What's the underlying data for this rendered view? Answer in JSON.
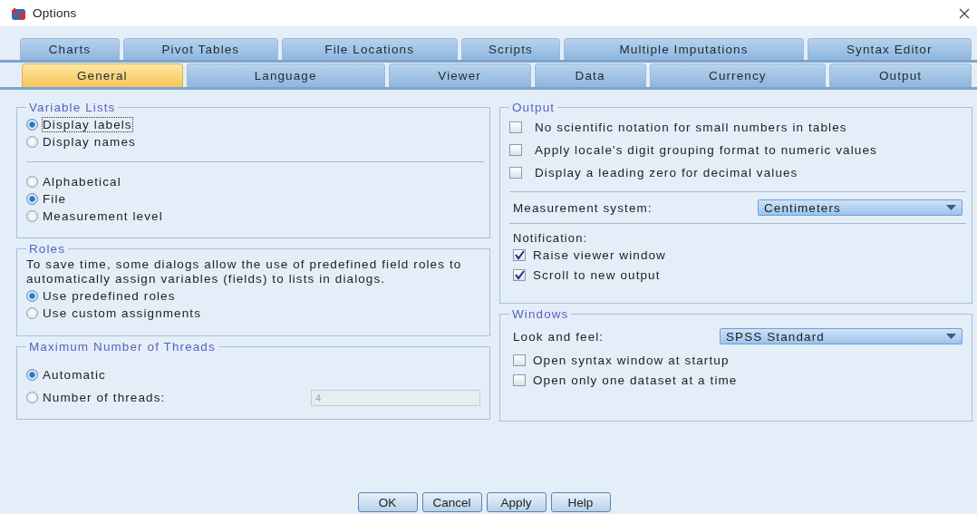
{
  "window": {
    "title": "Options"
  },
  "tabs_row1": [
    {
      "label": "Charts",
      "selected": false
    },
    {
      "label": "Pivot Tables",
      "selected": false
    },
    {
      "label": "File Locations",
      "selected": false
    },
    {
      "label": "Scripts",
      "selected": false
    },
    {
      "label": "Multiple Imputations",
      "selected": false
    },
    {
      "label": "Syntax Editor",
      "selected": false
    }
  ],
  "tabs_row2": [
    {
      "label": "General",
      "selected": true
    },
    {
      "label": "Language",
      "selected": false
    },
    {
      "label": "Viewer",
      "selected": false
    },
    {
      "label": "Data",
      "selected": false
    },
    {
      "label": "Currency",
      "selected": false
    },
    {
      "label": "Output",
      "selected": false
    }
  ],
  "variable_lists": {
    "title": "Variable Lists",
    "display": [
      {
        "label": "Display labels",
        "selected": true
      },
      {
        "label": "Display names",
        "selected": false
      }
    ],
    "order": [
      {
        "label": "Alphabetical",
        "selected": false
      },
      {
        "label": "File",
        "selected": true
      },
      {
        "label": "Measurement level",
        "selected": false
      }
    ]
  },
  "roles": {
    "title": "Roles",
    "description": "To save time, some dialogs allow the use of predefined field roles to automatically assign variables (fields) to lists in dialogs.",
    "options": [
      {
        "label": "Use predefined roles",
        "selected": true
      },
      {
        "label": "Use custom assignments",
        "selected": false
      }
    ]
  },
  "threads": {
    "title": "Maximum Number of Threads",
    "options": [
      {
        "label": "Automatic",
        "selected": true
      },
      {
        "label": "Number of threads:",
        "selected": false
      }
    ],
    "threads_field": {
      "value": "4",
      "disabled": true
    }
  },
  "output": {
    "title": "Output",
    "checkboxes": [
      {
        "label": "No scientific notation for small numbers in tables",
        "checked": false
      },
      {
        "label": "Apply locale's digit  grouping format to numeric values",
        "checked": false
      },
      {
        "label": "Display a leading zero for decimal values",
        "checked": false
      }
    ],
    "measurement": {
      "label": "Measurement system:",
      "value": "Centimeters"
    },
    "notification_label": "Notification:",
    "notifications": [
      {
        "label": "Raise viewer window",
        "checked": true
      },
      {
        "label": "Scroll to new output",
        "checked": true
      }
    ]
  },
  "windows": {
    "title": "Windows",
    "look": {
      "label": "Look and feel:",
      "value": "SPSS Standard"
    },
    "checkboxes": [
      {
        "label": "Open syntax window at startup",
        "checked": false
      },
      {
        "label": "Open only one dataset at a time",
        "checked": false
      }
    ]
  },
  "buttons": [
    "OK",
    "Cancel",
    "Apply",
    "Help"
  ]
}
